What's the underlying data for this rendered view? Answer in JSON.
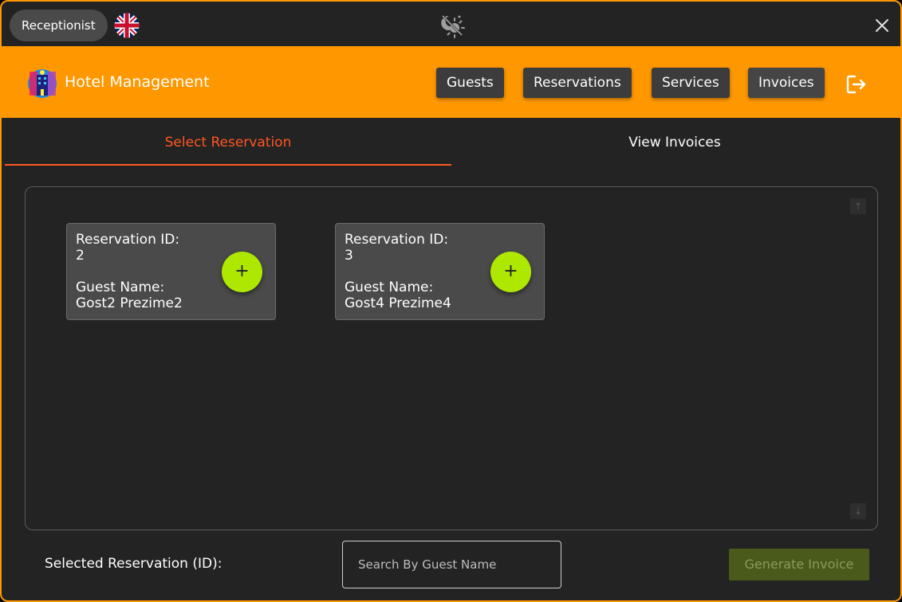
{
  "titlebar": {
    "role": "Receptionist",
    "language_icon": "uk-flag-icon",
    "theme_icon": "theme-toggle-icon",
    "close_icon": "close-icon"
  },
  "header": {
    "app_title": "Hotel Management",
    "nav": [
      {
        "label": "Guests"
      },
      {
        "label": "Reservations"
      },
      {
        "label": "Services"
      },
      {
        "label": "Invoices"
      }
    ],
    "active_nav": "Invoices",
    "logout_icon": "logout-icon",
    "background_color": "#ff9800"
  },
  "tabs": [
    {
      "label": "Select Reservation",
      "active": true
    },
    {
      "label": "View Invoices",
      "active": false
    }
  ],
  "accent_color": "#ff5722",
  "reservations": [
    {
      "id_label": "Reservation ID:",
      "id": "2",
      "guest_label": "Guest Name:",
      "guest": "Gost2 Prezime2",
      "add_symbol": "+"
    },
    {
      "id_label": "Reservation ID:",
      "id": "3",
      "guest_label": "Guest Name:",
      "guest": "Gost4 Prezime4",
      "add_symbol": "+"
    }
  ],
  "footer": {
    "selected_label": "Selected Reservation (ID):",
    "search_placeholder": "Search By Guest Name",
    "search_value": "",
    "generate_label": "Generate Invoice"
  }
}
